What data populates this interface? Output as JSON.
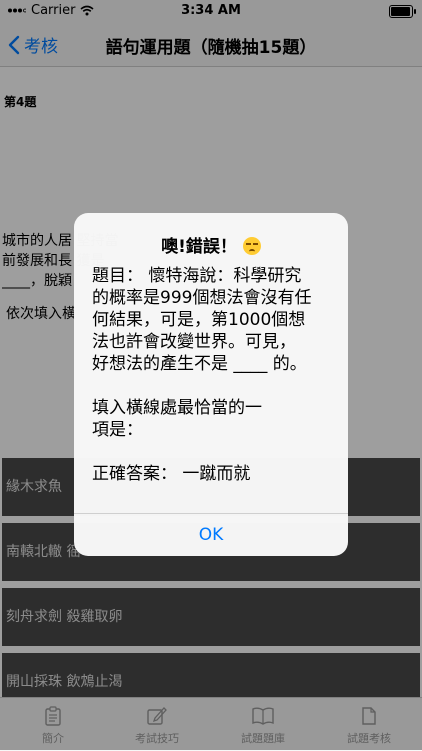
{
  "status_bar": {
    "carrier": "Carrier",
    "time": "3:34 AM",
    "battery_level": 0.95
  },
  "nav": {
    "back_label": "考核",
    "title": "語句運用題（隨機抽15題）"
  },
  "question": {
    "number_label": "第4題",
    "passage_lines": [
      "城市的人居                                                         堅持當",
      "前發展和長                                                         獲是",
      "____，脫穎"
    ],
    "fill_prompt": "依次填入橫"
  },
  "options": [
    {
      "label": "緣木求魚 "
    },
    {
      "label": "南轅北轍 徭"
    },
    {
      "label": "刻舟求劍 殺雞取卵"
    },
    {
      "label": "開山採珠 飲鴆止渴"
    }
  ],
  "tabbar": {
    "items": [
      {
        "label": "簡介",
        "icon": "clipboard-icon"
      },
      {
        "label": "考試技巧",
        "icon": "pencil-square-icon"
      },
      {
        "label": "試題題庫",
        "icon": "book-icon"
      },
      {
        "label": "試題考核",
        "icon": "document-icon"
      }
    ]
  },
  "alert": {
    "title": "噢!錯誤！",
    "emoji_icon": "pensive-face-icon",
    "message_lines": [
      "題目：  懷特海說：科學研究",
      "的概率是999個想法會沒有任",
      "何結果，可是，第1000個想",
      "法也許會改變世界。可見，",
      "好想法的產生不是 ____ 的。",
      "",
      " 填入橫線處最恰當的一",
      "項是：",
      "",
      "正確答案：   一蹴而就"
    ],
    "ok_label": "OK"
  },
  "colors": {
    "accent": "#007aff",
    "option_bg": "#4a4a4a",
    "bar_bg": "#f7f7f7"
  }
}
